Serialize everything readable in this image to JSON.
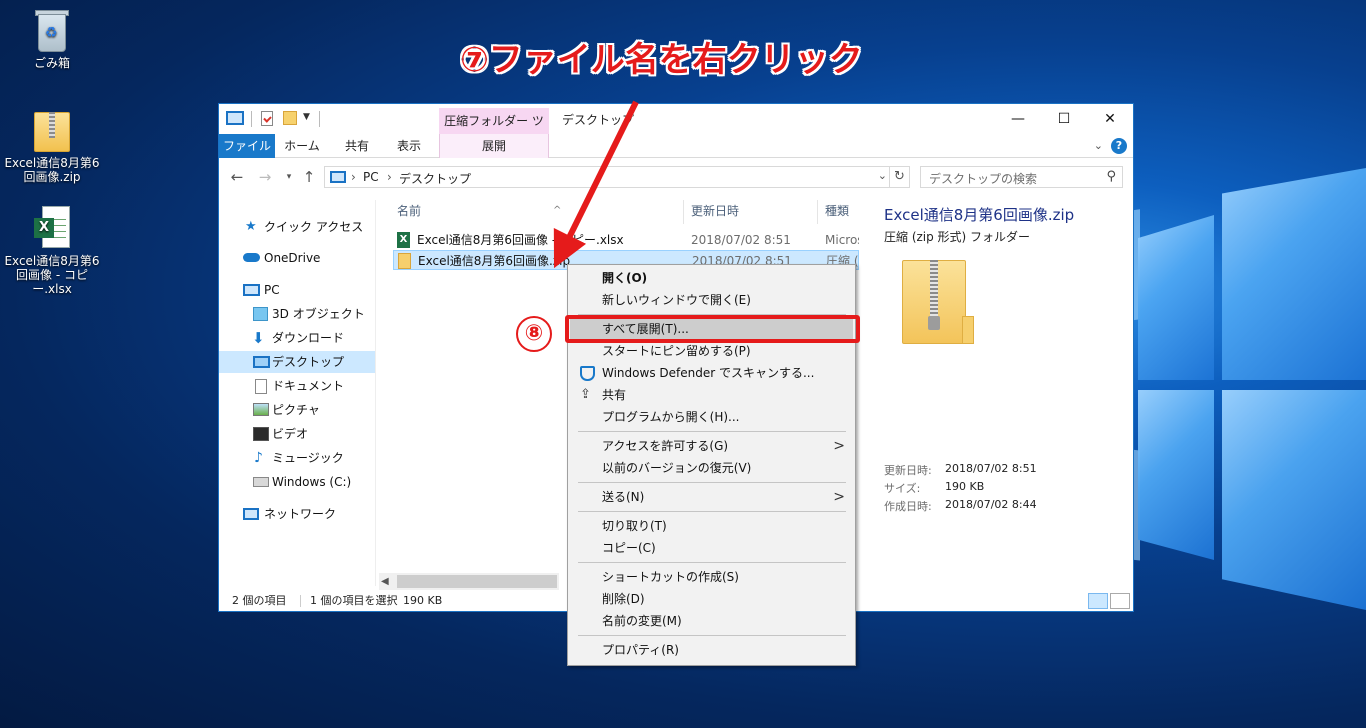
{
  "desktop": {
    "icons": [
      {
        "label": "ごみ箱"
      },
      {
        "label": "Excel通信8月第6回画像.zip"
      },
      {
        "label": "Excel通信8月第6回画像 - コピー.xlsx"
      }
    ]
  },
  "annotation": {
    "headline": "⑦ファイル名を右クリック",
    "step8": "⑧"
  },
  "window": {
    "context_tab_header": "圧縮フォルダー ツール",
    "title": "デスクトップ",
    "tabs": [
      "ファイル",
      "ホーム",
      "共有",
      "表示",
      "展開"
    ],
    "address": {
      "crumbs": [
        "PC",
        "デスクトップ"
      ]
    },
    "search_placeholder": "デスクトップの検索",
    "nav": [
      {
        "label": "クイック アクセス"
      },
      {
        "label": "OneDrive"
      },
      {
        "label": "PC"
      },
      {
        "label": "3D オブジェクト"
      },
      {
        "label": "ダウンロード"
      },
      {
        "label": "デスクトップ"
      },
      {
        "label": "ドキュメント"
      },
      {
        "label": "ピクチャ"
      },
      {
        "label": "ビデオ"
      },
      {
        "label": "ミュージック"
      },
      {
        "label": "Windows (C:)"
      },
      {
        "label": "ネットワーク"
      }
    ],
    "columns": {
      "name": "名前",
      "modified": "更新日時",
      "type": "種類"
    },
    "files": [
      {
        "name": "Excel通信8月第6回画像 - コピー.xlsx",
        "modified": "2018/07/02 8:51",
        "type": "Microsoft"
      },
      {
        "name": "Excel通信8月第6回画像.zip",
        "modified": "2018/07/02 8:51",
        "type": "圧縮 (zip"
      }
    ],
    "details": {
      "title": "Excel通信8月第6回画像.zip",
      "subtitle": "圧縮 (zip 形式) フォルダー",
      "props": [
        {
          "key": "更新日時:",
          "value": "2018/07/02 8:51"
        },
        {
          "key": "サイズ:",
          "value": "190 KB"
        },
        {
          "key": "作成日時:",
          "value": "2018/07/02 8:44"
        }
      ]
    },
    "status": {
      "count": "2 個の項目",
      "selected": "1 個の項目を選択",
      "size": "190 KB"
    }
  },
  "context_menu": {
    "items": [
      {
        "label": "開く(O)",
        "bold": true
      },
      {
        "label": "新しいウィンドウで開く(E)"
      },
      {
        "label": "すべて展開(T)..."
      },
      {
        "label": "スタートにピン留めする(P)"
      },
      {
        "label": "Windows Defender でスキャンする..."
      },
      {
        "label": "共有"
      },
      {
        "label": "プログラムから開く(H)..."
      },
      {
        "label": "アクセスを許可する(G)"
      },
      {
        "label": "以前のバージョンの復元(V)"
      },
      {
        "label": "送る(N)"
      },
      {
        "label": "切り取り(T)"
      },
      {
        "label": "コピー(C)"
      },
      {
        "label": "ショートカットの作成(S)"
      },
      {
        "label": "削除(D)"
      },
      {
        "label": "名前の変更(M)"
      },
      {
        "label": "プロパティ(R)"
      }
    ],
    "submenu_indicator": ">"
  },
  "colors": {
    "accent": "#1979ca",
    "annotation_red": "#e51b1b",
    "selection": "#cce8ff"
  }
}
